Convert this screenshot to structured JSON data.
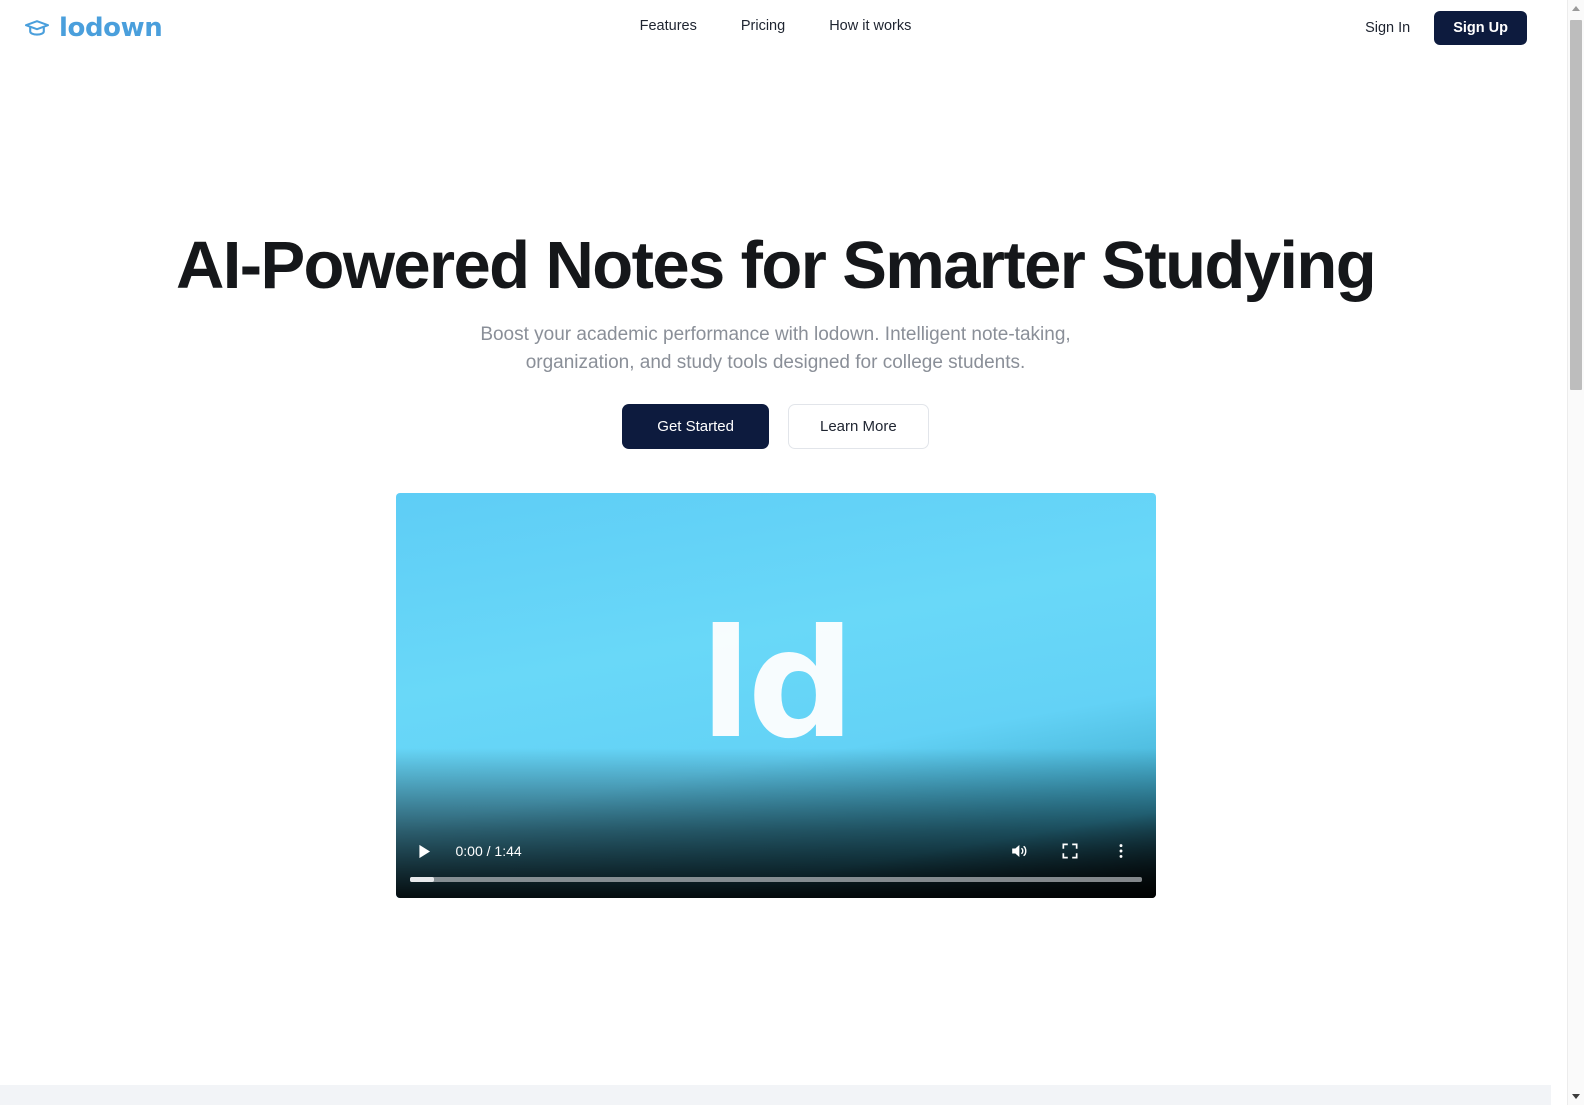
{
  "header": {
    "brand": {
      "name": "lodown",
      "icon": "graduation-cap-icon",
      "color": "#4a9fdc"
    },
    "nav": [
      {
        "label": "Features"
      },
      {
        "label": "Pricing"
      },
      {
        "label": "How it works"
      }
    ],
    "sign_in_label": "Sign In",
    "sign_up_label": "Sign Up",
    "sign_up_bg": "#0d1b3e"
  },
  "hero": {
    "title": "AI-Powered Notes for Smarter Studying",
    "subtitle": "Boost your academic performance with lodown. Intelligent note-taking, organization, and study tools designed for college students.",
    "primary_cta": "Get Started",
    "secondary_cta": "Learn More"
  },
  "video": {
    "poster_mark": "ld",
    "poster_bg_top": "#63d3f7",
    "poster_bg_bottom": "#0a1418",
    "current_time": "0:00",
    "duration": "1:44",
    "time_display": "0:00 / 1:44",
    "progress_percent": 0,
    "controls": {
      "play": "play-icon",
      "volume": "volume-icon",
      "fullscreen": "fullscreen-icon",
      "more": "more-options-icon"
    }
  },
  "bottom_band": {
    "color": "#f2f4f7"
  },
  "scrollbar": {
    "position_percent": 2
  }
}
